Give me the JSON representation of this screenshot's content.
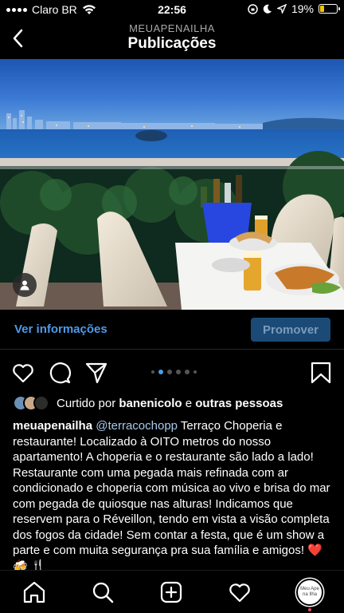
{
  "status_bar": {
    "carrier": "Claro BR",
    "time": "22:56",
    "battery": "19%"
  },
  "header": {
    "account": "MEUAPENAILHA",
    "title": "Publicações"
  },
  "promo": {
    "link_label": "Ver informações",
    "button_label": "Promover"
  },
  "carousel": {
    "active_index": 1,
    "dots": 6
  },
  "likes": {
    "prefix": "Curtido por",
    "user": "banenicolo",
    "joiner": "e",
    "others": "outras pessoas"
  },
  "caption": {
    "username": "meuapenailha",
    "mention": "@terracochopp",
    "text": "Terraço Choperia e restaurante! Localizado à OITO metros do nosso apartamento! A choperia e o restaurante são lado a lado! Restaurante com uma pegada mais refinada com ar condicionado e choperia com música ao vivo e brisa do mar com pegada de quiosque nas alturas! Indicamos que reservem para o Réveillon, tendo em vista a visão completa dos fogos da cidade! Sem contar a festa, que é um show a parte e com muita segurança pra sua família e amigos! ❤️ 🍻 🍴"
  },
  "profile_tab": {
    "label": "Meu Ape na Ilha"
  },
  "colors": {
    "link": "#4d9be8",
    "promote_bg": "#1b4a77",
    "notification": "#ed4956"
  }
}
